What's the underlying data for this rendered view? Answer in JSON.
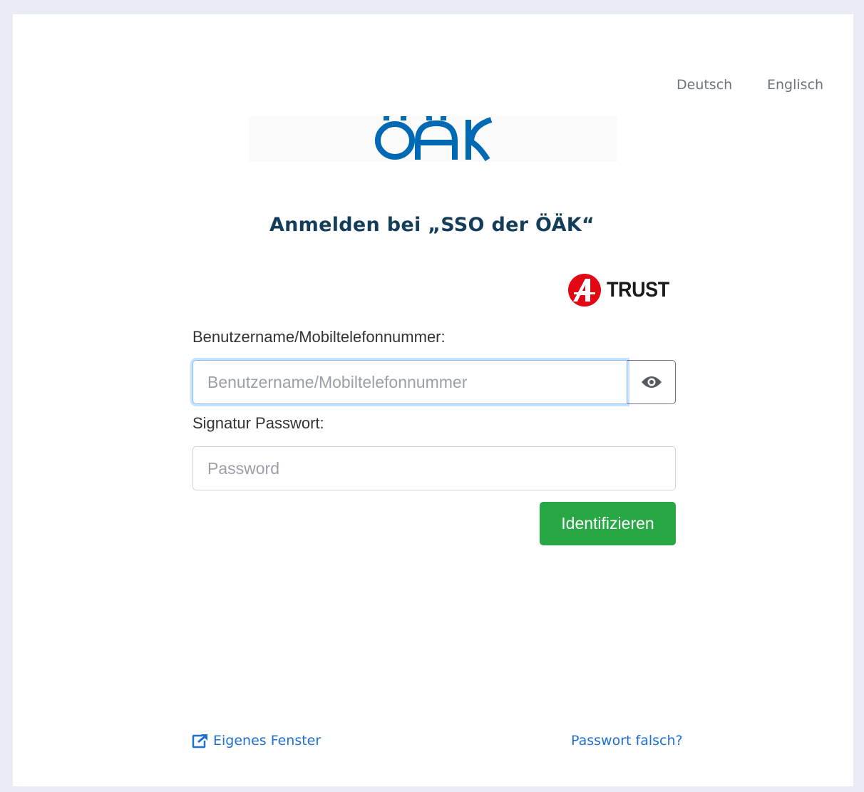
{
  "language": {
    "german": "Deutsch",
    "english": "Englisch"
  },
  "logo": {
    "name": "ÖÄK logo",
    "color": "#0069b4"
  },
  "title": "Anmelden bei „SSO der ÖÄK“",
  "atrust": {
    "text": "TRUST",
    "accent_color": "#e30613"
  },
  "form": {
    "username_label": "Benutzername/Mobiltelefonnummer:",
    "username_placeholder": "Benutzername/Mobiltelefonnummer",
    "username_value": "",
    "toggle_icon": "eye-icon",
    "password_label": "Signatur Passwort:",
    "password_placeholder": "Password",
    "password_value": "",
    "submit_label": "Identifizieren",
    "submit_color": "#28a745"
  },
  "footer": {
    "own_window_label": "Eigenes Fenster",
    "own_window_icon": "external-link-icon",
    "forgot_password_label": "Passwort falsch?",
    "link_color": "#1f6fd1"
  }
}
